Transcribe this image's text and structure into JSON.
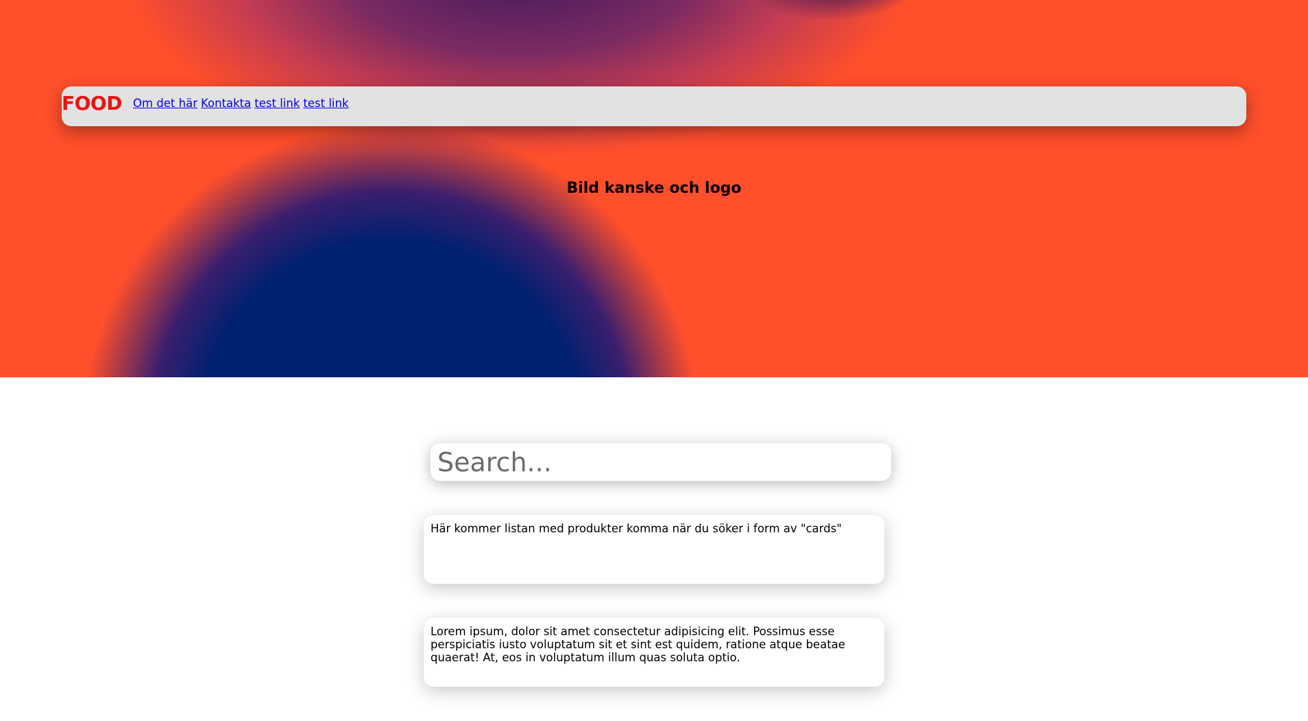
{
  "navbar": {
    "brand": "FOOD",
    "links": [
      "Om det här",
      "Kontakta",
      "test link",
      "test link"
    ]
  },
  "hero": {
    "title": "Bild kanske och logo"
  },
  "search": {
    "placeholder": "Search...",
    "value": ""
  },
  "cards": [
    {
      "text": "Här kommer listan med produkter komma när du söker i form av \"cards\""
    },
    {
      "text": "Lorem ipsum, dolor sit amet consectetur adipisicing elit. Possimus esse perspiciatis iusto voluptatum sit et sint est quidem, ratione atque beatae quaerat! At, eos in voluptatum illum quas soluta optio."
    }
  ],
  "colors": {
    "hero_orange": "#ff4f2b",
    "hero_navy": "#002070",
    "navbar_bg": "#e2e2e2",
    "brand_red": "#ee1111",
    "link_blue": "#0000ee"
  }
}
